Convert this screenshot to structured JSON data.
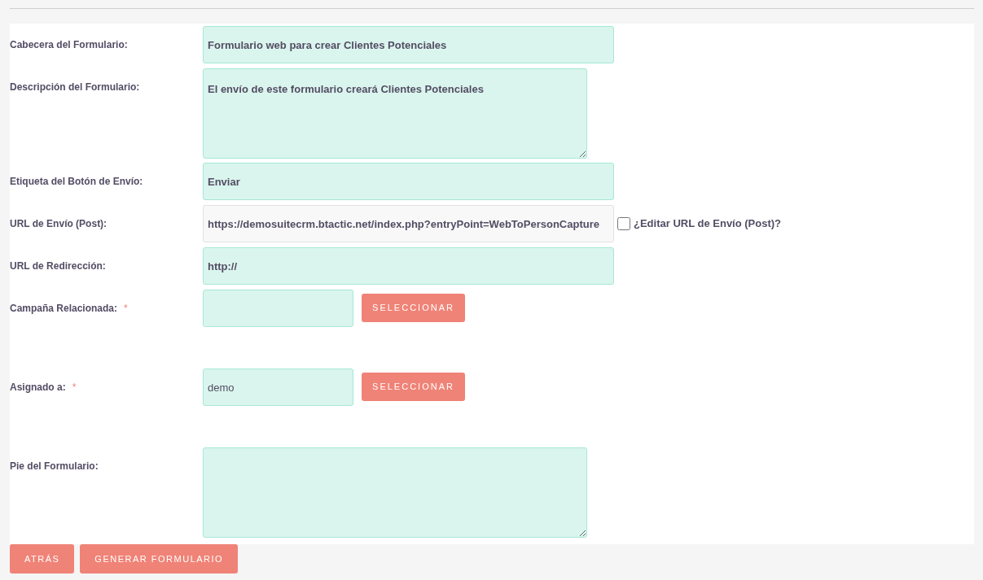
{
  "fields": [
    {
      "kind": "text",
      "label": "Cabecera del Formulario:",
      "value": "Formulario web para crear Clientes Potenciales"
    },
    {
      "kind": "textarea",
      "label": "Descripción del Formulario:",
      "value": "El envío de este formulario creará Clientes Potenciales"
    },
    {
      "kind": "text",
      "label": "Etiqueta del Botón de Envío:",
      "value": "Enviar"
    },
    {
      "kind": "readonly",
      "label": "URL de Envío (Post):",
      "value": "https://demosuitecrm.btactic.net/index.php?entryPoint=WebToPersonCapture",
      "checkbox": {
        "label": "¿Editar URL de Envío (Post)?",
        "checked": false
      }
    },
    {
      "kind": "text",
      "label": "URL de Redirección:",
      "value": "http://"
    },
    {
      "kind": "select",
      "label": "Campaña Relacionada:",
      "required_mark": "*",
      "button": "SELECCIONAR"
    },
    {
      "kind": "select",
      "label": "Asignado a:",
      "required_mark": "*",
      "value": "demo",
      "button": "SELECCIONAR"
    },
    {
      "kind": "textarea",
      "label": "Pie del Formulario:"
    }
  ],
  "actions": [
    "ATRÁS",
    "GENERAR FORMULARIO"
  ]
}
